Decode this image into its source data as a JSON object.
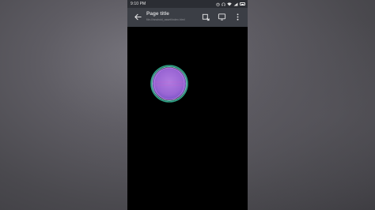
{
  "status_bar": {
    "time": "9:10 PM",
    "icons": [
      "alarm-icon",
      "headset-icon",
      "wifi-icon",
      "signal-icon",
      "battery-icon"
    ]
  },
  "toolbar": {
    "title": "Page title",
    "url": "file:///android_asset/index.html"
  },
  "colors": {
    "status_bar": "#2b2d33",
    "toolbar": "#3b3e45",
    "content_background": "#000000",
    "orb_fill": "#9f6ad6",
    "orb_ring": "#3fbf9a"
  }
}
